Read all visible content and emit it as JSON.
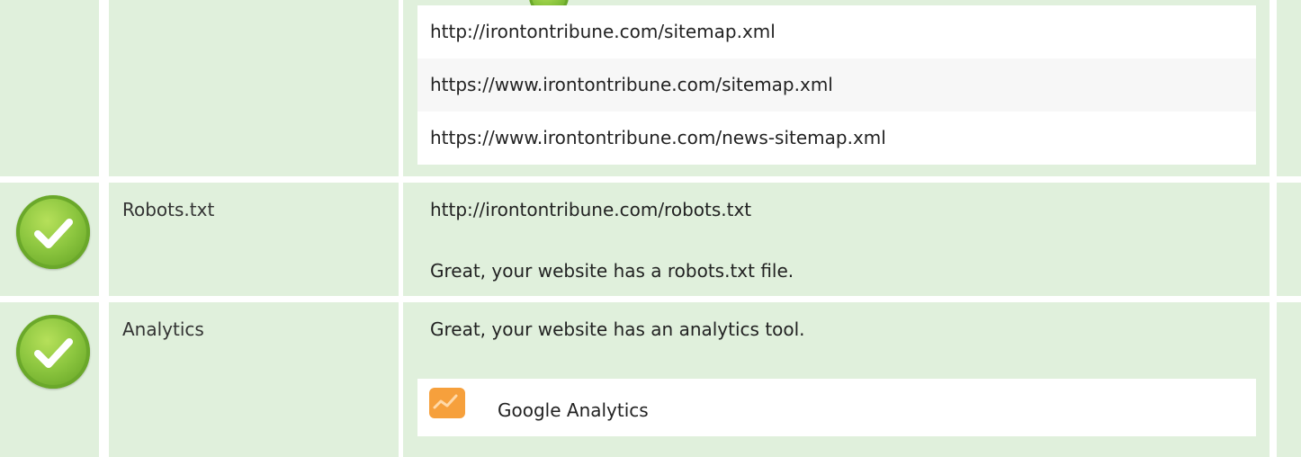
{
  "sitemaps": {
    "urls": [
      "http://irontontribune.com/sitemap.xml",
      "https://www.irontontribune.com/sitemap.xml",
      "https://www.irontontribune.com/news-sitemap.xml"
    ]
  },
  "robots": {
    "label": "Robots.txt",
    "url": "http://irontontribune.com/robots.txt",
    "message": "Great, your website has a robots.txt file."
  },
  "analytics": {
    "label": "Analytics",
    "message": "Great, your website has an analytics tool.",
    "tool_name": "Google Analytics"
  },
  "colors": {
    "cell_bg": "#e0f0dc",
    "check_green": "#8cc63f",
    "ga_orange": "#f6a03c",
    "alt_row": "#f7f7f7"
  }
}
